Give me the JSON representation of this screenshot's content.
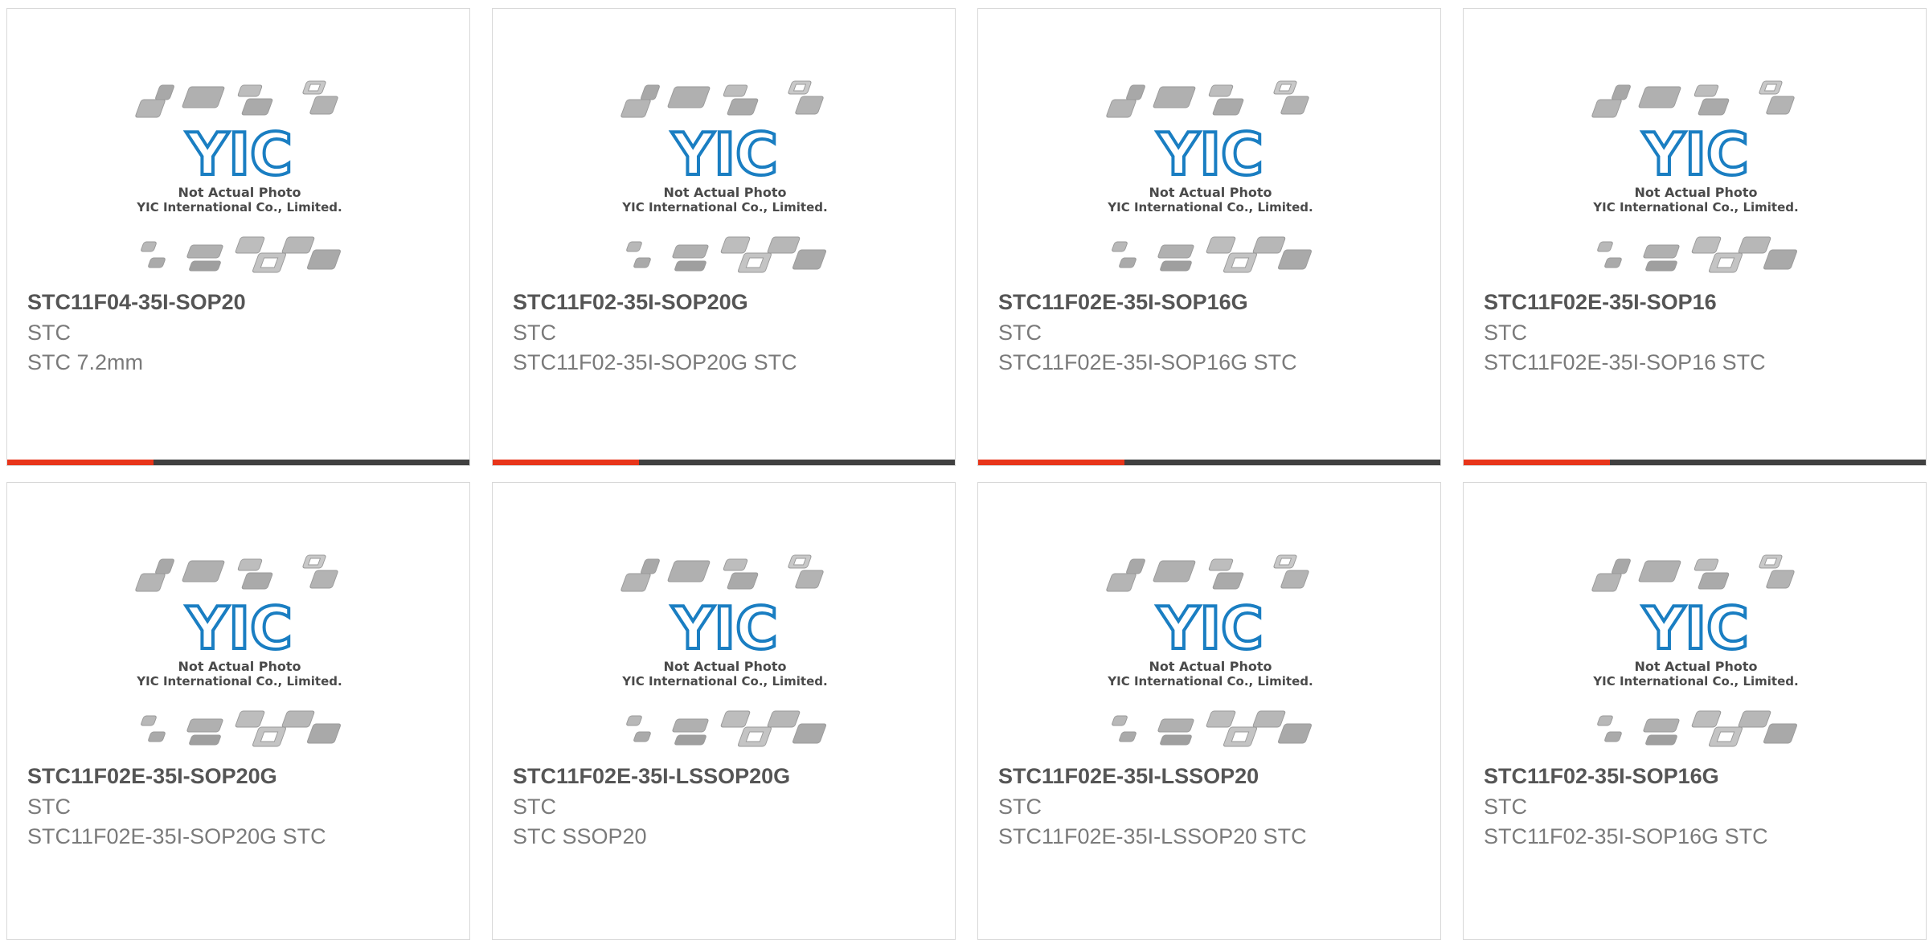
{
  "placeholder": {
    "line1": "Not Actual Photo",
    "line2": "YIC International Co., Limited.",
    "logo": "YIC"
  },
  "colors": {
    "accent": "#e8351a",
    "bar": "#404040",
    "logo": "#1a7ec2"
  },
  "products": [
    {
      "part": "STC11F04-35I-SOP20",
      "brand": "STC",
      "desc": "STC 7.2mm"
    },
    {
      "part": "STC11F02-35I-SOP20G",
      "brand": "STC",
      "desc": "STC11F02-35I-SOP20G STC"
    },
    {
      "part": "STC11F02E-35I-SOP16G",
      "brand": "STC",
      "desc": "STC11F02E-35I-SOP16G STC"
    },
    {
      "part": "STC11F02E-35I-SOP16",
      "brand": "STC",
      "desc": "STC11F02E-35I-SOP16 STC"
    },
    {
      "part": "STC11F02E-35I-SOP20G",
      "brand": "STC",
      "desc": "STC11F02E-35I-SOP20G STC"
    },
    {
      "part": "STC11F02E-35I-LSSOP20G",
      "brand": "STC",
      "desc": "STC SSOP20"
    },
    {
      "part": "STC11F02E-35I-LSSOP20",
      "brand": "STC",
      "desc": "STC11F02E-35I-LSSOP20 STC"
    },
    {
      "part": "STC11F02-35I-SOP16G",
      "brand": "STC",
      "desc": "STC11F02-35I-SOP16G STC"
    }
  ]
}
